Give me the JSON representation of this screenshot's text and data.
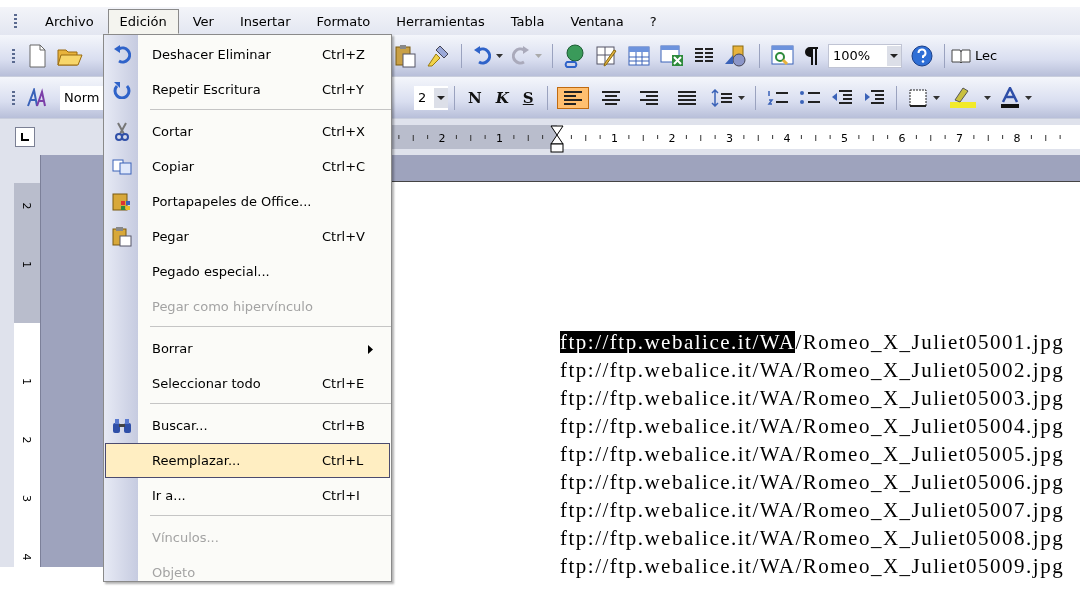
{
  "menu_bar": [
    {
      "label": "Archivo",
      "selected": false
    },
    {
      "label": "Edición",
      "selected": true
    },
    {
      "label": "Ver",
      "selected": false
    },
    {
      "label": "Insertar",
      "selected": false
    },
    {
      "label": "Formato",
      "selected": false
    },
    {
      "label": "Herramientas",
      "selected": false
    },
    {
      "label": "Tabla",
      "selected": false
    },
    {
      "label": "Ventana",
      "selected": false
    },
    {
      "label": "?",
      "selected": false
    }
  ],
  "standard_toolbar": {
    "zoom": "100%",
    "read_label": "Lec"
  },
  "formatting_toolbar": {
    "style": "Norm",
    "font_size": "2",
    "bold": "N",
    "italic": "K",
    "underline": "S",
    "align_buttons": [
      {
        "selected": true
      },
      {
        "selected": false
      },
      {
        "selected": false
      },
      {
        "selected": false
      }
    ]
  },
  "ruler": {
    "left_margin_numbers": [
      "2",
      "1"
    ],
    "numbers": [
      "1",
      "2",
      "3",
      "4",
      "5",
      "6",
      "7",
      "8"
    ]
  },
  "vertical_ruler": {
    "top_margin_numbers": [
      "2",
      "1"
    ],
    "numbers": [
      "1",
      "2",
      "3",
      "4"
    ]
  },
  "edit_menu": [
    {
      "kind": "command",
      "label": "Deshacer Eliminar",
      "shortcut": "Ctrl+Z",
      "disabled": false,
      "selected": false,
      "submenu": false
    },
    {
      "kind": "command",
      "label": "Repetir Escritura",
      "shortcut": "Ctrl+Y",
      "disabled": false,
      "selected": false,
      "submenu": false
    },
    {
      "kind": "separator"
    },
    {
      "kind": "command",
      "label": "Cortar",
      "shortcut": "Ctrl+X",
      "disabled": false,
      "selected": false,
      "submenu": false
    },
    {
      "kind": "command",
      "label": "Copiar",
      "shortcut": "Ctrl+C",
      "disabled": false,
      "selected": false,
      "submenu": false
    },
    {
      "kind": "command",
      "label": "Portapapeles de Office...",
      "disabled": false,
      "selected": false,
      "submenu": false
    },
    {
      "kind": "command",
      "label": "Pegar",
      "shortcut": "Ctrl+V",
      "disabled": false,
      "selected": false,
      "submenu": false
    },
    {
      "kind": "command",
      "label": "Pegado especial...",
      "disabled": false,
      "selected": false,
      "submenu": false
    },
    {
      "kind": "command",
      "label": "Pegar como hipervínculo",
      "disabled": true,
      "selected": false,
      "submenu": false
    },
    {
      "kind": "separator"
    },
    {
      "kind": "command",
      "label": "Borrar",
      "disabled": false,
      "selected": false,
      "submenu": true
    },
    {
      "kind": "command",
      "label": "Seleccionar todo",
      "shortcut": "Ctrl+E",
      "disabled": false,
      "selected": false,
      "submenu": false
    },
    {
      "kind": "separator"
    },
    {
      "kind": "command",
      "label": "Buscar...",
      "shortcut": "Ctrl+B",
      "disabled": false,
      "selected": false,
      "submenu": false
    },
    {
      "kind": "command",
      "label": "Reemplazar...",
      "shortcut": "Ctrl+L",
      "disabled": false,
      "selected": true,
      "submenu": false
    },
    {
      "kind": "command",
      "label": "Ir a...",
      "shortcut": "Ctrl+I",
      "disabled": false,
      "selected": false,
      "submenu": false
    },
    {
      "kind": "separator"
    },
    {
      "kind": "command",
      "label": "Vínculos...",
      "disabled": true,
      "selected": false,
      "submenu": false
    },
    {
      "kind": "command",
      "label": "Objeto",
      "disabled": true,
      "selected": false,
      "submenu": false
    }
  ],
  "document_lines": [
    {
      "segments": [
        {
          "text": "ftp://ftp.webalice.it/WA",
          "selected": true
        },
        {
          "text": "/Romeo_X_Juliet05001.jpg",
          "selected": false
        }
      ]
    },
    {
      "segments": [
        {
          "text": "ftp://ftp.webalice.it/WA/Romeo_X_Juliet05002.jpg",
          "selected": false
        }
      ]
    },
    {
      "segments": [
        {
          "text": "ftp://ftp.webalice.it/WA/Romeo_X_Juliet05003.jpg",
          "selected": false
        }
      ]
    },
    {
      "segments": [
        {
          "text": "ftp://ftp.webalice.it/WA/Romeo_X_Juliet05004.jpg",
          "selected": false
        }
      ]
    },
    {
      "segments": [
        {
          "text": "ftp://ftp.webalice.it/WA/Romeo_X_Juliet05005.jpg",
          "selected": false
        }
      ]
    },
    {
      "segments": [
        {
          "text": "ftp://ftp.webalice.it/WA/Romeo_X_Juliet05006.jpg",
          "selected": false
        }
      ]
    },
    {
      "segments": [
        {
          "text": "ftp://ftp.webalice.it/WA/Romeo_X_Juliet05007.jpg",
          "selected": false
        }
      ]
    },
    {
      "segments": [
        {
          "text": "ftp://ftp.webalice.it/WA/Romeo_X_Juliet05008.jpg",
          "selected": false
        }
      ]
    },
    {
      "segments": [
        {
          "text": "ftp://ftp.webalice.it/WA/Romeo_X_Juliet05009.jpg",
          "selected": false
        }
      ]
    }
  ]
}
